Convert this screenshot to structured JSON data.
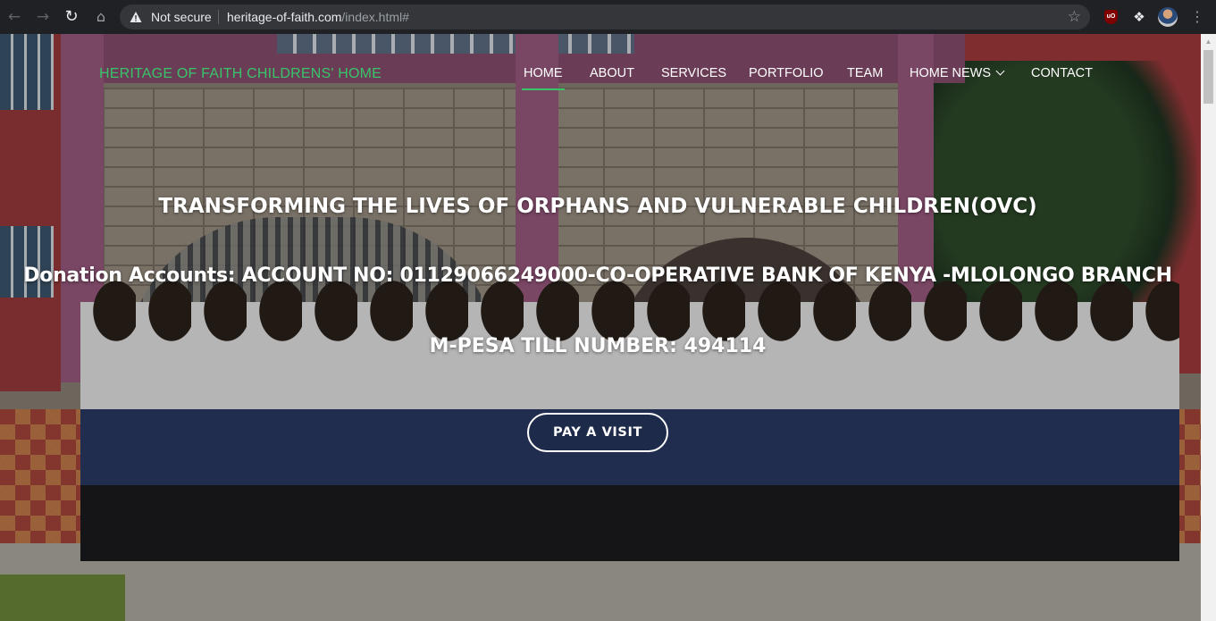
{
  "browser": {
    "security_label": "Not secure",
    "url_host": "heritage-of-faith.com",
    "url_path": "/index.html#",
    "icons": [
      "back-arrow-icon",
      "forward-arrow-icon",
      "reload-icon",
      "home-icon",
      "warning-icon",
      "star-icon",
      "ublock-origin-icon",
      "extensions-puzzle-icon",
      "profile-avatar",
      "more-vert-icon"
    ],
    "ublock_badge": "uO"
  },
  "site": {
    "brand": "HERITAGE OF FAITH CHILDRENS' HOME",
    "brand_color": "#38c46a",
    "nav": {
      "home": "HOME",
      "about": "ABOUT",
      "services": "SERVICES",
      "portfolio": "PORTFOLIO",
      "team": "TEAM",
      "home_news": "HOME NEWS",
      "contact": "CONTACT"
    },
    "active_nav": "HOME"
  },
  "hero": {
    "line1": "TRANSFORMING THE LIVES OF ORPHANS AND VULNERABLE CHILDREN(OVC)",
    "line2": "Donation Accounts: ACCOUNT NO: 01129066249000-CO-OPERATIVE BANK OF KENYA -MLOLONGO BRANCH",
    "line3": "M-PESA TILL NUMBER: 494114",
    "cta_label": "PAY A VISIT"
  }
}
